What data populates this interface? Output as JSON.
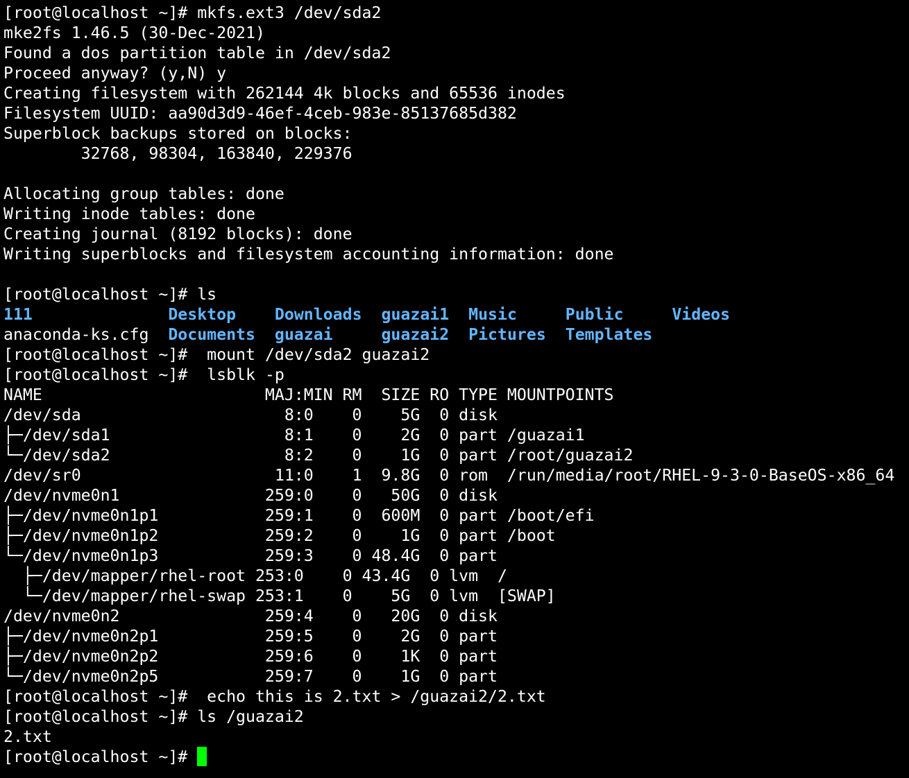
{
  "terminal": {
    "prompt": "[root@localhost ~]#",
    "lines": [
      "[root@localhost ~]# mkfs.ext3 /dev/sda2",
      "mke2fs 1.46.5 (30-Dec-2021)",
      "Found a dos partition table in /dev/sda2",
      "Proceed anyway? (y,N) y",
      "Creating filesystem with 262144 4k blocks and 65536 inodes",
      "Filesystem UUID: aa90d3d9-46ef-4ceb-983e-85137685d382",
      "Superblock backups stored on blocks:",
      "        32768, 98304, 163840, 229376",
      "",
      "Allocating group tables: done",
      "Writing inode tables: done",
      "Creating journal (8192 blocks): done",
      "Writing superblocks and filesystem accounting information: done",
      "",
      "[root@localhost ~]# ls"
    ],
    "ls_output": {
      "row1": [
        {
          "name": "111",
          "pad": "              ",
          "type": "dir"
        },
        {
          "name": "Desktop",
          "pad": "    ",
          "type": "dir"
        },
        {
          "name": "Downloads",
          "pad": "  ",
          "type": "dir"
        },
        {
          "name": "guazai1",
          "pad": "  ",
          "type": "dir"
        },
        {
          "name": "Music",
          "pad": "     ",
          "type": "dir"
        },
        {
          "name": "Public",
          "pad": "     ",
          "type": "dir"
        },
        {
          "name": "Videos",
          "pad": "",
          "type": "dir"
        }
      ],
      "row2": [
        {
          "name": "anaconda-ks.cfg",
          "pad": "  ",
          "type": "file"
        },
        {
          "name": "Documents",
          "pad": "  ",
          "type": "dir"
        },
        {
          "name": "guazai",
          "pad": "     ",
          "type": "dir"
        },
        {
          "name": "guazai2",
          "pad": "  ",
          "type": "dir"
        },
        {
          "name": "Pictures",
          "pad": "  ",
          "type": "dir"
        },
        {
          "name": "Templates",
          "pad": "",
          "type": "dir"
        }
      ]
    },
    "lines_after_ls": [
      "[root@localhost ~]#  mount /dev/sda2 guazai2",
      "[root@localhost ~]#  lsblk -p",
      "NAME                       MAJ:MIN RM  SIZE RO TYPE MOUNTPOINTS",
      "/dev/sda                     8:0    0    5G  0 disk",
      "├─/dev/sda1                  8:1    0    2G  0 part /guazai1",
      "└─/dev/sda2                  8:2    0    1G  0 part /root/guazai2",
      "/dev/sr0                    11:0    1  9.8G  0 rom  /run/media/root/RHEL-9-3-0-BaseOS-x86_64",
      "/dev/nvme0n1               259:0    0   50G  0 disk",
      "├─/dev/nvme0n1p1           259:1    0  600M  0 part /boot/efi",
      "├─/dev/nvme0n1p2           259:2    0    1G  0 part /boot",
      "└─/dev/nvme0n1p3           259:3    0 48.4G  0 part",
      "  ├─/dev/mapper/rhel-root 253:0    0 43.4G  0 lvm  /",
      "  └─/dev/mapper/rhel-swap 253:1    0    5G  0 lvm  [SWAP]",
      "/dev/nvme0n2               259:4    0   20G  0 disk",
      "├─/dev/nvme0n2p1           259:5    0    2G  0 part",
      "├─/dev/nvme0n2p2           259:6    0    1K  0 part",
      "└─/dev/nvme0n2p5           259:7    0    1G  0 part",
      "[root@localhost ~]#  echo this is 2.txt > /guazai2/2.txt",
      "[root@localhost ~]# ls /guazai2",
      "2.txt"
    ],
    "final_prompt": "[root@localhost ~]# ",
    "colors": {
      "background": "#000000",
      "foreground": "#ffffff",
      "directory": "#62b6ff",
      "cursor": "#00ff00"
    }
  }
}
